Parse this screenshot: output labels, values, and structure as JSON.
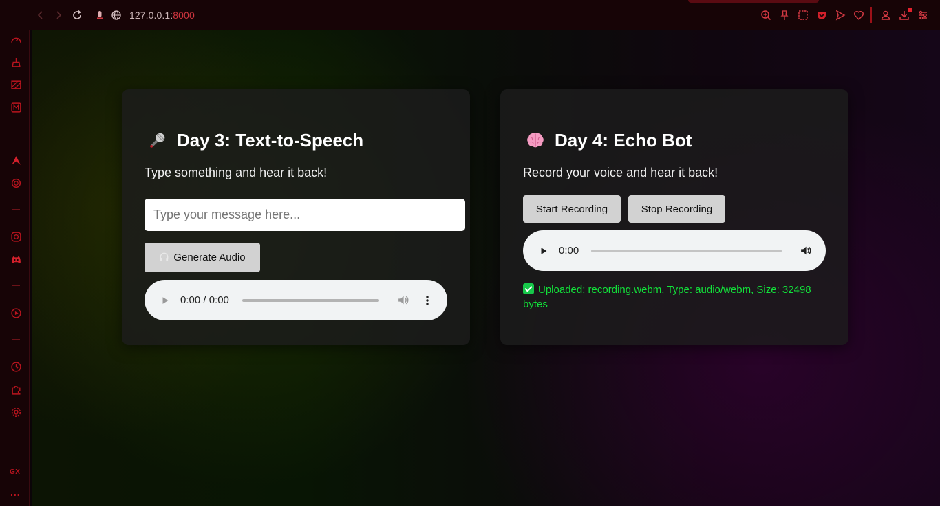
{
  "browser": {
    "url_host": "127.0.0.1:",
    "url_port": "8000",
    "toolbar_icons": [
      "zoom-icon",
      "pin-icon",
      "snapshot-icon",
      "pocket-icon",
      "send-icon",
      "heart-icon",
      "account-icon",
      "download-icon",
      "easy-setup-icon"
    ],
    "sidebar_icons": [
      "speed-dial-icon",
      "cleaner-icon",
      "rgb-icon",
      "mod-icon",
      "aria-icon",
      "chatgpt-icon",
      "instagram-icon",
      "discord-icon",
      "player-icon",
      "history-icon",
      "extensions-icon",
      "settings-icon"
    ],
    "sidebar_gx": "GX",
    "sidebar_more": "...",
    "accent": "#d0363f"
  },
  "cards": {
    "tts": {
      "title": "Day 3: Text-to-Speech",
      "title_icon": "microphone-emoji",
      "subtitle": "Type something and hear it back!",
      "input_placeholder": "Type your message here...",
      "input_value": "",
      "button_icon": "headphones-emoji",
      "button_label": "Generate Audio",
      "player_time": "0:00 / 0:00"
    },
    "echo": {
      "title": "Day 4: Echo Bot",
      "title_icon": "brain-emoji",
      "subtitle": "Record your voice and hear it back!",
      "start_label": "Start Recording",
      "stop_label": "Stop Recording",
      "player_time": "0:00",
      "status_text": "Uploaded: recording.webm, Type: audio/webm, Size: 32498 bytes",
      "status_color": "#12e23a"
    }
  }
}
